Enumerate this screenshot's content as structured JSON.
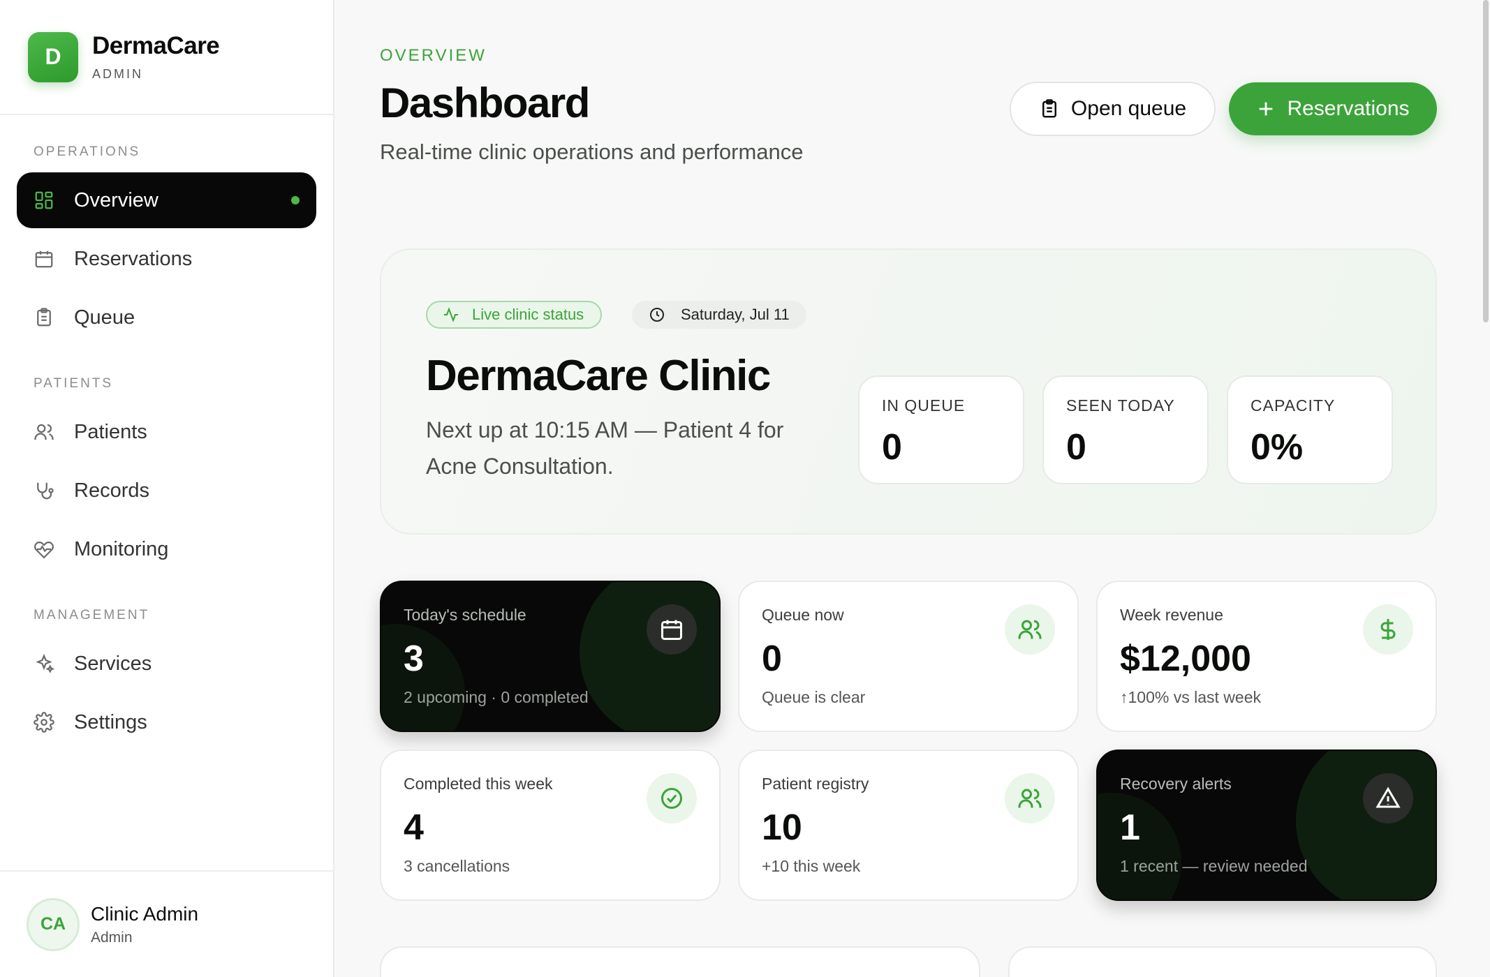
{
  "brand": {
    "name": "DermaCare",
    "role": "ADMIN",
    "logo_letter": "D",
    "accent": "#3ca33b"
  },
  "sidebar": {
    "sections": [
      {
        "title": "OPERATIONS",
        "items": [
          {
            "label": "Overview",
            "icon": "grid-icon",
            "active": true
          },
          {
            "label": "Reservations",
            "icon": "calendar-icon"
          },
          {
            "label": "Queue",
            "icon": "clipboard-icon"
          }
        ]
      },
      {
        "title": "PATIENTS",
        "items": [
          {
            "label": "Patients",
            "icon": "users-icon"
          },
          {
            "label": "Records",
            "icon": "stethoscope-icon"
          },
          {
            "label": "Monitoring",
            "icon": "heart-pulse-icon"
          }
        ]
      },
      {
        "title": "MANAGEMENT",
        "items": [
          {
            "label": "Services",
            "icon": "sparkles-icon"
          },
          {
            "label": "Settings",
            "icon": "gear-icon"
          }
        ]
      }
    ],
    "user": {
      "initials": "CA",
      "name": "Clinic Admin",
      "role": "Admin"
    }
  },
  "header": {
    "eyebrow": "OVERVIEW",
    "title": "Dashboard",
    "subtitle": "Real-time clinic operations and performance",
    "open_queue_label": "Open queue",
    "reservations_label": "Reservations"
  },
  "hero": {
    "status_pill": "Live clinic status",
    "date_pill": "Saturday, Jul 11",
    "title": "DermaCare Clinic",
    "description": "Next up at 10:15 AM — Patient 4 for Acne Consultation.",
    "stats": [
      {
        "label": "IN QUEUE",
        "value": "0"
      },
      {
        "label": "SEEN TODAY",
        "value": "0"
      },
      {
        "label": "CAPACITY",
        "value": "0%"
      }
    ]
  },
  "kpis": [
    {
      "label": "Today's schedule",
      "value": "3",
      "sub": "2 upcoming · 0 completed",
      "icon": "calendar-icon",
      "dark": true
    },
    {
      "label": "Queue now",
      "value": "0",
      "sub": "Queue is clear",
      "icon": "users-icon"
    },
    {
      "label": "Week revenue",
      "value": "$12,000",
      "sub": "↑100% vs last week",
      "icon": "dollar-icon"
    },
    {
      "label": "Completed this week",
      "value": "4",
      "sub": "3 cancellations",
      "icon": "check-circle-icon"
    },
    {
      "label": "Patient registry",
      "value": "10",
      "sub": "+10 this week",
      "icon": "users-icon"
    },
    {
      "label": "Recovery alerts",
      "value": "1",
      "sub": "1 recent — review needed",
      "icon": "warning-icon",
      "dark": true
    }
  ]
}
